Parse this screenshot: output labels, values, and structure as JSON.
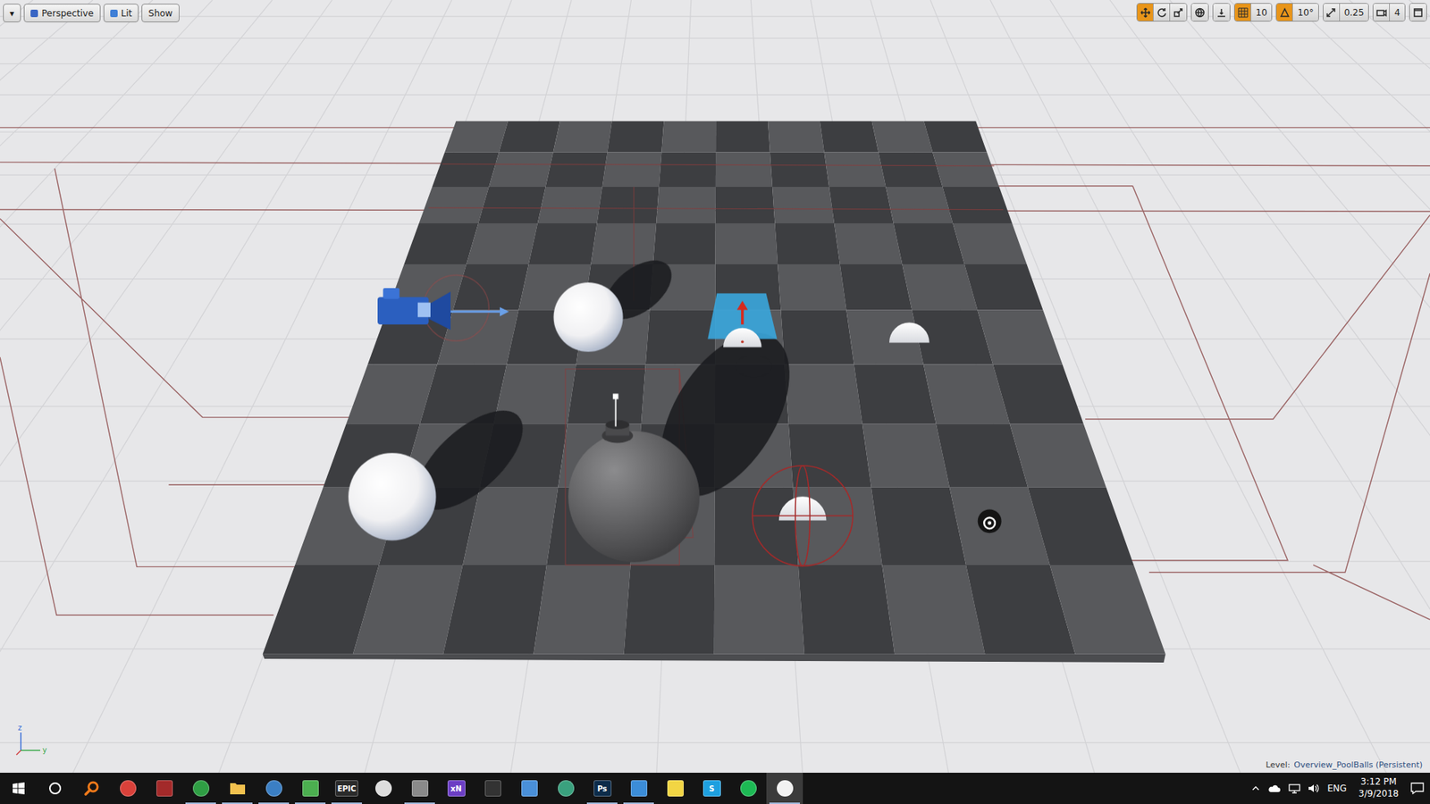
{
  "viewport": {
    "left_toolbar": [
      {
        "label": "▾",
        "kind": "menu"
      },
      {
        "label": "Perspective",
        "kind": "mode"
      },
      {
        "label": "Lit",
        "kind": "mode"
      },
      {
        "label": "Show",
        "kind": "menu"
      }
    ],
    "right_toolbar": [
      [
        {
          "kind": "translate",
          "selected": true
        },
        {
          "kind": "rotate",
          "selected": false
        },
        {
          "kind": "scale",
          "selected": false
        }
      ],
      [
        {
          "kind": "coordinate-space",
          "selected": false
        }
      ],
      [
        {
          "kind": "surface-snap",
          "selected": false
        }
      ],
      [
        {
          "kind": "grid-snap",
          "selected": true,
          "value": "10"
        }
      ],
      [
        {
          "kind": "rotation-snap",
          "selected": true,
          "value": "10°"
        }
      ],
      [
        {
          "kind": "scale-snap",
          "selected": false,
          "value": "0.25"
        }
      ],
      [
        {
          "kind": "camera-speed",
          "selected": false,
          "value": "4"
        }
      ],
      [
        {
          "kind": "maximize",
          "selected": false
        }
      ]
    ],
    "axis_labels": [
      "z",
      "y"
    ],
    "level": {
      "label": "Level:",
      "value": "Overview_PoolBalls (Persistent)"
    }
  },
  "taskbar": {
    "apps": [
      {
        "kind": "magnifier",
        "color": "#f07a1a",
        "running": false,
        "active": false
      },
      {
        "kind": "circle",
        "color": "#d9413a",
        "running": false,
        "active": false
      },
      {
        "kind": "square",
        "color": "#a32a2a",
        "running": false,
        "active": false
      },
      {
        "kind": "circle",
        "color": "#2f9e44",
        "running": true,
        "active": false
      },
      {
        "kind": "folder",
        "color": "#f2c14e",
        "running": true,
        "active": false
      },
      {
        "kind": "circle",
        "color": "#3b7fc4",
        "running": true,
        "active": false
      },
      {
        "kind": "square",
        "color": "#4caf50",
        "running": true,
        "active": false
      },
      {
        "kind": "text",
        "label": "EPIC",
        "color": "#2b2b2b",
        "running": true,
        "active": false
      },
      {
        "kind": "circle",
        "color": "#dddddd",
        "running": false,
        "active": false
      },
      {
        "kind": "square",
        "color": "#8a8a8a",
        "running": true,
        "active": false
      },
      {
        "kind": "text",
        "label": "xN",
        "color": "#6c3fc4",
        "running": false,
        "active": false
      },
      {
        "kind": "square",
        "color": "#333333",
        "running": false,
        "active": false
      },
      {
        "kind": "square",
        "color": "#4a90d9",
        "running": false,
        "active": false
      },
      {
        "kind": "circle",
        "color": "#3aa17e",
        "running": false,
        "active": false
      },
      {
        "kind": "text",
        "label": "Ps",
        "color": "#0d2c4a",
        "running": true,
        "active": false
      },
      {
        "kind": "square",
        "color": "#3c8dd8",
        "running": true,
        "active": false
      },
      {
        "kind": "square",
        "color": "#f2d544",
        "running": false,
        "active": false
      },
      {
        "kind": "text",
        "label": "S",
        "color": "#1ea0e0",
        "running": false,
        "active": false
      },
      {
        "kind": "circle",
        "color": "#1db954",
        "running": false,
        "active": false
      },
      {
        "kind": "circle",
        "color": "#f2f2f2",
        "running": true,
        "active": true
      }
    ],
    "tray": {
      "language": "ENG",
      "time": "3:12 PM",
      "date": "3/9/2018"
    }
  }
}
